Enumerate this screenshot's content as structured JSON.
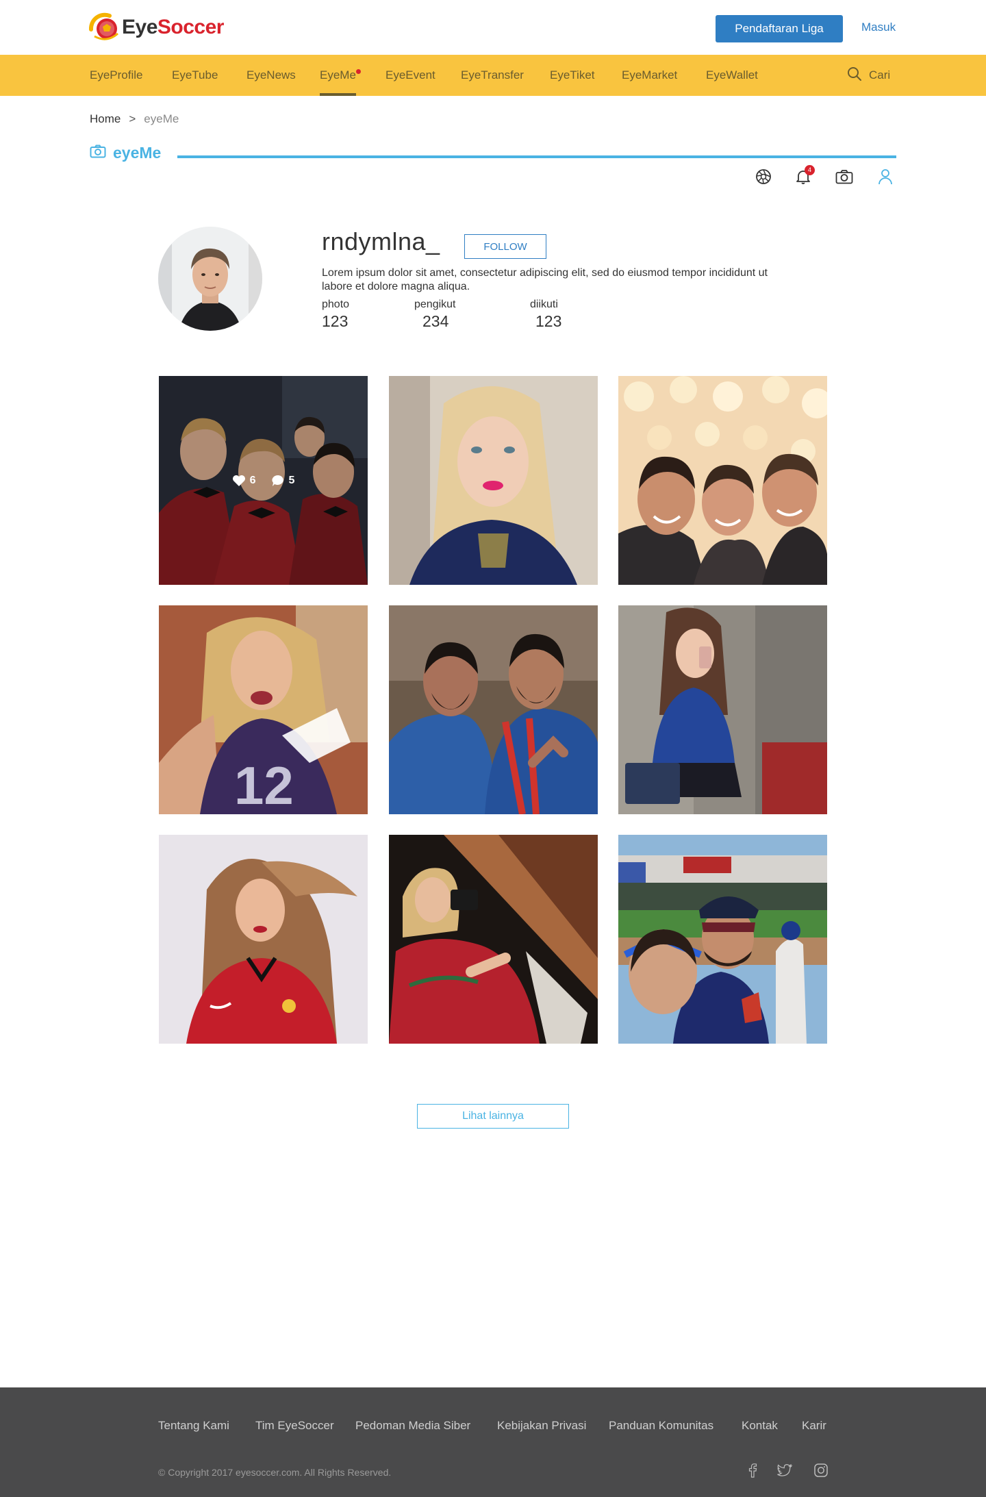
{
  "header": {
    "logo_text_1": "Eye",
    "logo_text_2": "Soccer",
    "register_label": "Pendaftaran Liga",
    "login_label": "Masuk"
  },
  "nav": {
    "items": [
      {
        "label": "EyeProfile"
      },
      {
        "label": "EyeTube"
      },
      {
        "label": "EyeNews"
      },
      {
        "label": "EyeMe",
        "active": true
      },
      {
        "label": "EyeEvent"
      },
      {
        "label": "EyeTransfer"
      },
      {
        "label": "EyeTiket"
      },
      {
        "label": "EyeMarket"
      },
      {
        "label": "EyeWallet"
      }
    ],
    "search_label": "Cari"
  },
  "breadcrumb": {
    "home": "Home",
    "separator": ">",
    "current": "eyeMe"
  },
  "section": {
    "title": "eyeMe",
    "icon": "camera-icon",
    "notification_count": "4",
    "toolbar_icons": [
      "aperture-icon",
      "bell-icon",
      "camera-icon",
      "user-icon"
    ]
  },
  "profile": {
    "username": "rndymlna_",
    "follow_label": "FOLLOW",
    "bio": "Lorem ipsum dolor sit amet, consectetur adipiscing elit, sed do eiusmod tempor incididunt ut labore et dolore magna aliqua.",
    "stats": [
      {
        "label": "photo",
        "value": "123"
      },
      {
        "label": "pengikut",
        "value": "234"
      },
      {
        "label": "diikuti",
        "value": "123"
      }
    ]
  },
  "grid": {
    "hover_likes": "6",
    "hover_comments": "5",
    "photos": [
      {
        "subject": "group selfie in red tuxedos"
      },
      {
        "subject": "blonde woman selfie in blue jersey"
      },
      {
        "subject": "three men selfie with bokeh lights"
      },
      {
        "subject": "woman selfie in purple number 12 jersey"
      },
      {
        "subject": "two men in blue cricket jerseys"
      },
      {
        "subject": "mirror selfie in blue jersey"
      },
      {
        "subject": "woman with long hair in red jersey"
      },
      {
        "subject": "woman mirror selfie in red jersey"
      },
      {
        "subject": "two men selfie at baseball stadium"
      }
    ]
  },
  "more_label": "Lihat lainnya",
  "footer": {
    "links": [
      {
        "label": "Tentang Kami"
      },
      {
        "label": "Tim EyeSoccer"
      },
      {
        "label": "Pedoman Media Siber"
      },
      {
        "label": "Kebijakan Privasi"
      },
      {
        "label": "Panduan Komunitas"
      },
      {
        "label": "Kontak"
      },
      {
        "label": "Karir"
      }
    ],
    "copyright": "© Copyright 2017 eyesoccer.com. All Rights Reserved.",
    "social_icons": [
      "facebook-icon",
      "twitter-icon",
      "instagram-icon"
    ]
  },
  "colors": {
    "nav_bg": "#f9c43f",
    "primary_blue": "#2f7ec3",
    "accent_cyan": "#4ab3e3",
    "brand_red": "#d9232d",
    "footer_bg": "#4a4a4b"
  }
}
